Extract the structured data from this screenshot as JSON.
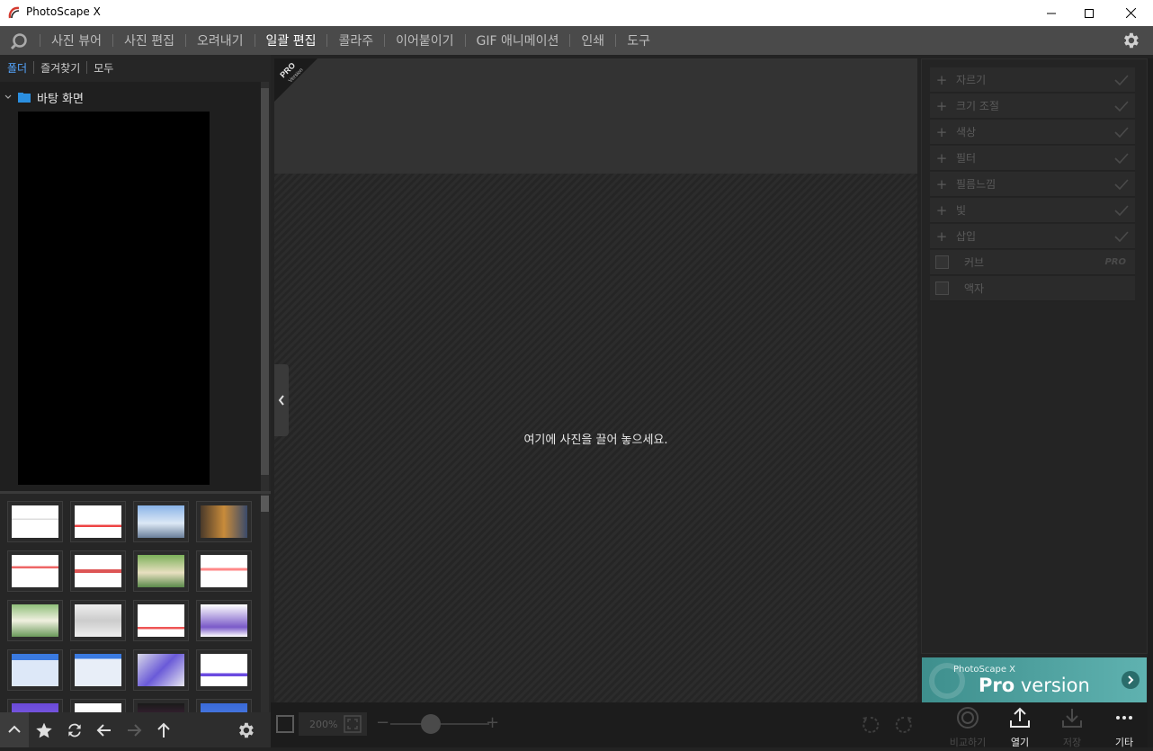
{
  "window": {
    "title": "PhotoScape X"
  },
  "menu": {
    "items": [
      "사진 뷰어",
      "사진 편집",
      "오려내기",
      "일괄 편집",
      "콜라주",
      "이어붙이기",
      "GIF 애니메이션",
      "인쇄",
      "도구"
    ],
    "active": "일괄 편집"
  },
  "left": {
    "tabs": [
      "폴더",
      "즐겨찾기",
      "모두"
    ],
    "active_tab": "폴더",
    "tree": {
      "folder_label": "바탕 화면"
    }
  },
  "center": {
    "drop_text": "여기에 사진을 끌어 놓으세요.",
    "pro_ribbon": {
      "line1": "PRO",
      "line2": "Version"
    }
  },
  "right": {
    "tools": [
      {
        "label": "자르기",
        "kind": "plus"
      },
      {
        "label": "크기 조절",
        "kind": "plus"
      },
      {
        "label": "색상",
        "kind": "plus"
      },
      {
        "label": "필터",
        "kind": "plus"
      },
      {
        "label": "필름느낌",
        "kind": "plus"
      },
      {
        "label": "빛",
        "kind": "plus"
      },
      {
        "label": "삽입",
        "kind": "plus"
      },
      {
        "label": "커브",
        "kind": "checkbox",
        "badge": "PRO"
      },
      {
        "label": "액자",
        "kind": "checkbox"
      }
    ],
    "banner": {
      "sub": "PhotoScape X",
      "pro": "Pro",
      "version": " version"
    }
  },
  "bottom": {
    "zoom": "200%",
    "actions": [
      {
        "label": "비교하기",
        "icon": "compare-icon",
        "enabled": false
      },
      {
        "label": "열기",
        "icon": "upload-icon",
        "enabled": true
      },
      {
        "label": "저장",
        "icon": "download-icon",
        "enabled": false
      },
      {
        "label": "기타",
        "icon": "more-icon",
        "enabled": true
      }
    ]
  },
  "colors": {
    "accent": "#55a6ff",
    "menubar": "#4a4a4a",
    "banner": "#4fa3a1"
  }
}
